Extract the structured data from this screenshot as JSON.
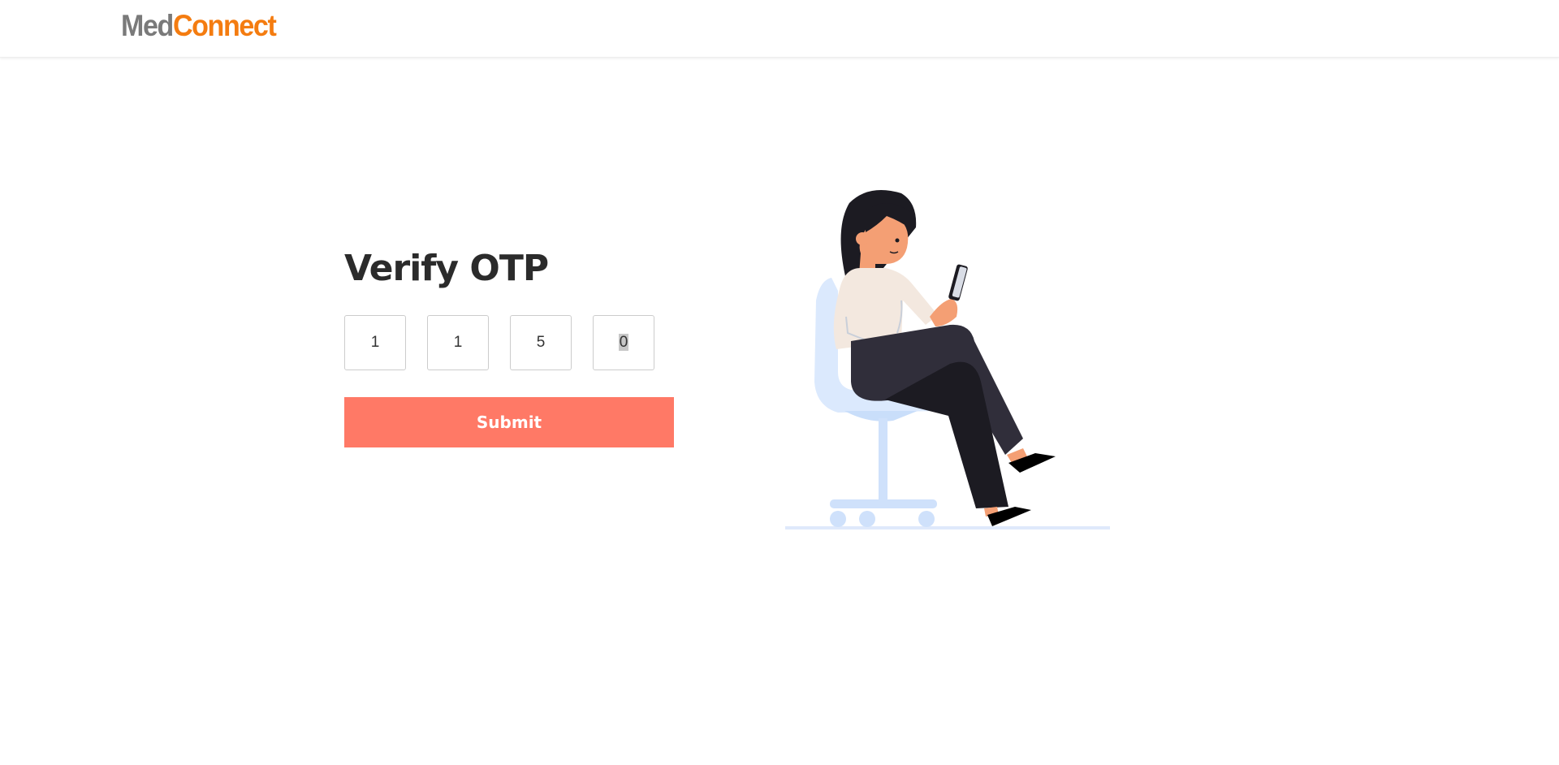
{
  "header": {
    "logo_part1": "Med",
    "logo_part2": "Connect",
    "logo_colors": {
      "med": "#7a7a7a",
      "connect": "#f47c10"
    }
  },
  "main": {
    "title": "Verify OTP",
    "otp_digits": [
      "1",
      "1",
      "5",
      "0"
    ],
    "submit_label": "Submit",
    "submit_color": "#ff7966",
    "illustration": "woman-sitting-on-chair-with-phone"
  }
}
